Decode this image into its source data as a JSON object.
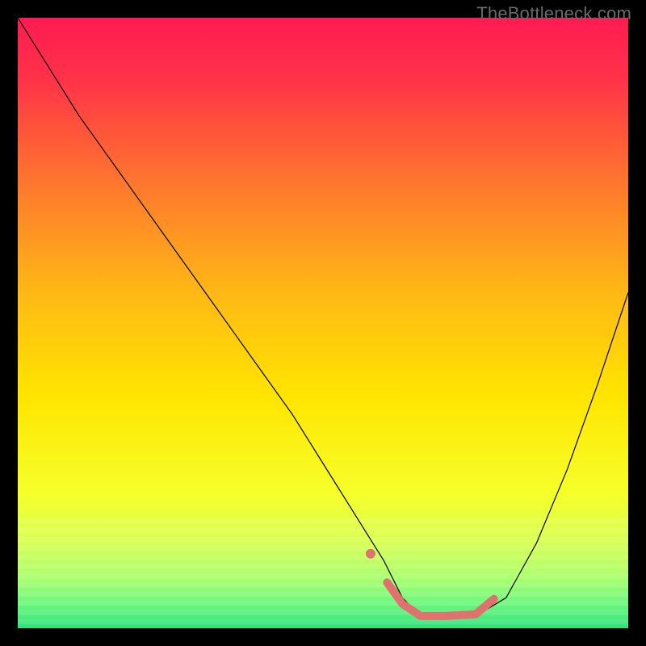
{
  "watermark": "TheBottleneck.com",
  "chart_data": {
    "type": "line",
    "title": "",
    "xlabel": "",
    "ylabel": "",
    "xlim": [
      0,
      100
    ],
    "ylim": [
      0,
      100
    ],
    "grid": false,
    "legend": false,
    "background_gradient": {
      "top_color": "#ff1b52",
      "mid_color": "#ffd500",
      "bottom_color": "#2fe37a",
      "green_band_start_y_pct": 82
    },
    "series": [
      {
        "name": "bottleneck-curve",
        "color": "#000000",
        "stroke_width": 1.2,
        "x": [
          0,
          5,
          10,
          15,
          20,
          25,
          30,
          35,
          40,
          45,
          50,
          55,
          60,
          63,
          66,
          70,
          75,
          80,
          85,
          90,
          95,
          100
        ],
        "values": [
          100,
          92,
          84,
          77,
          70,
          63,
          56,
          49,
          42,
          35,
          27,
          19,
          11,
          5,
          2,
          2,
          2,
          5,
          14,
          26,
          40,
          55
        ]
      },
      {
        "name": "optimal-range-highlight",
        "color": "#e0726e",
        "stroke_width": 10,
        "linecap": "round",
        "x": [
          60.5,
          63,
          66,
          70,
          75,
          78
        ],
        "values": [
          7.5,
          4,
          2,
          2,
          2.3,
          4.8
        ]
      },
      {
        "name": "optimal-range-dot",
        "color": "#e0726e",
        "marker": "circle",
        "marker_radius": 6,
        "x": [
          57.8
        ],
        "values": [
          12.2
        ]
      }
    ]
  }
}
